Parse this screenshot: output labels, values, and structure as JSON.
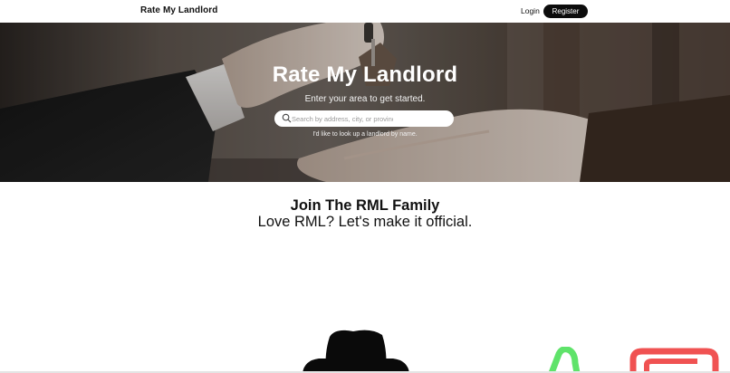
{
  "nav": {
    "brand": "Rate My Landlord",
    "login_label": "Login",
    "register_label": "Register"
  },
  "hero": {
    "title": "Rate My Landlord",
    "subtitle": "Enter your area to get started.",
    "search": {
      "placeholder": "Search by address, city, or province",
      "value": ""
    },
    "lookup_link": "I'd like to look up a landlord by name."
  },
  "join": {
    "title": "Join The RML Family",
    "subtitle": "Love RML? Let's make it official."
  },
  "colors": {
    "accent_dark": "#0c0c0c",
    "illustration_green": "#5fe36a",
    "illustration_red": "#f05252",
    "illustration_black": "#0a0a0a"
  },
  "icons": [
    "search-icon",
    "hat-illustration",
    "green-shape-illustration",
    "red-shape-illustration"
  ]
}
